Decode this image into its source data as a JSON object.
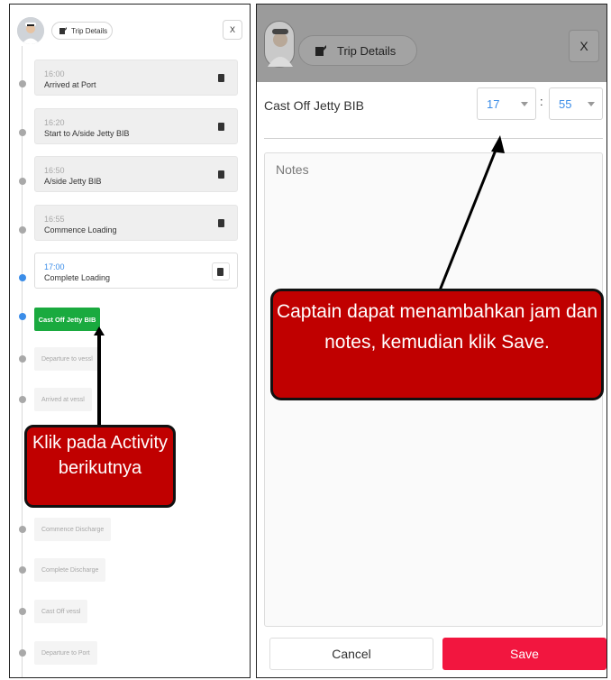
{
  "header": {
    "trip_details_label": "Trip Details",
    "close_label": "X"
  },
  "timeline": {
    "done": [
      {
        "time": "16:00",
        "name": "Arrived at Port"
      },
      {
        "time": "16:20",
        "name": "Start to A/side Jetty BIB"
      },
      {
        "time": "16:50",
        "name": "A/side Jetty BIB"
      },
      {
        "time": "16:55",
        "name": "Commence Loading"
      }
    ],
    "current": {
      "time": "17:00",
      "name": "Complete Loading"
    },
    "next": "Cast Off Jetty BIB",
    "pending": [
      "Departure to vessl",
      "Arrived at vessl",
      "Commence Discharge",
      "Complete Discharge",
      "Cast Off vessl",
      "Departure to Port"
    ]
  },
  "detail": {
    "activity_name": "Cast Off Jetty BIB",
    "hour_value": "17",
    "minute_value": "55",
    "separator": ":",
    "notes_placeholder": "Notes",
    "cancel_label": "Cancel",
    "save_label": "Save"
  },
  "callouts": {
    "left_text": "Klik pada Activity berikutnya",
    "right_text": "Captain dapat menambahkan jam dan notes, kemudian klik Save."
  },
  "colors": {
    "accent_blue": "#3b8de8",
    "next_green": "#1aaa3f",
    "save_red": "#f2163f",
    "callout_red": "#c00000"
  }
}
